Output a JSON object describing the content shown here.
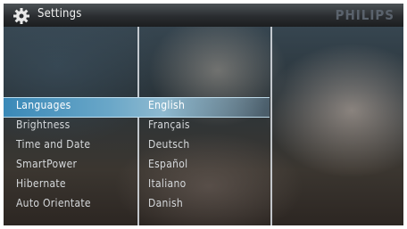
{
  "header": {
    "title": "Settings",
    "brand": "PHILIPS",
    "icon": "gear-icon"
  },
  "menu": {
    "items": [
      {
        "label": "Languages",
        "selected": true
      },
      {
        "label": "Brightness",
        "selected": false
      },
      {
        "label": "Time and Date",
        "selected": false
      },
      {
        "label": "SmartPower",
        "selected": false
      },
      {
        "label": "Hibernate",
        "selected": false
      },
      {
        "label": "Auto Orientate",
        "selected": false
      }
    ]
  },
  "languages": {
    "items": [
      {
        "label": "English",
        "selected": true
      },
      {
        "label": "Français",
        "selected": false
      },
      {
        "label": "Deutsch",
        "selected": false
      },
      {
        "label": "Español",
        "selected": false
      },
      {
        "label": "Italiano",
        "selected": false
      },
      {
        "label": "Danish",
        "selected": false
      }
    ]
  },
  "colors": {
    "highlight": "#3a89b8",
    "title_bar": "#2a2d30",
    "text": "#d6d9dc",
    "brand": "#5a626c"
  }
}
